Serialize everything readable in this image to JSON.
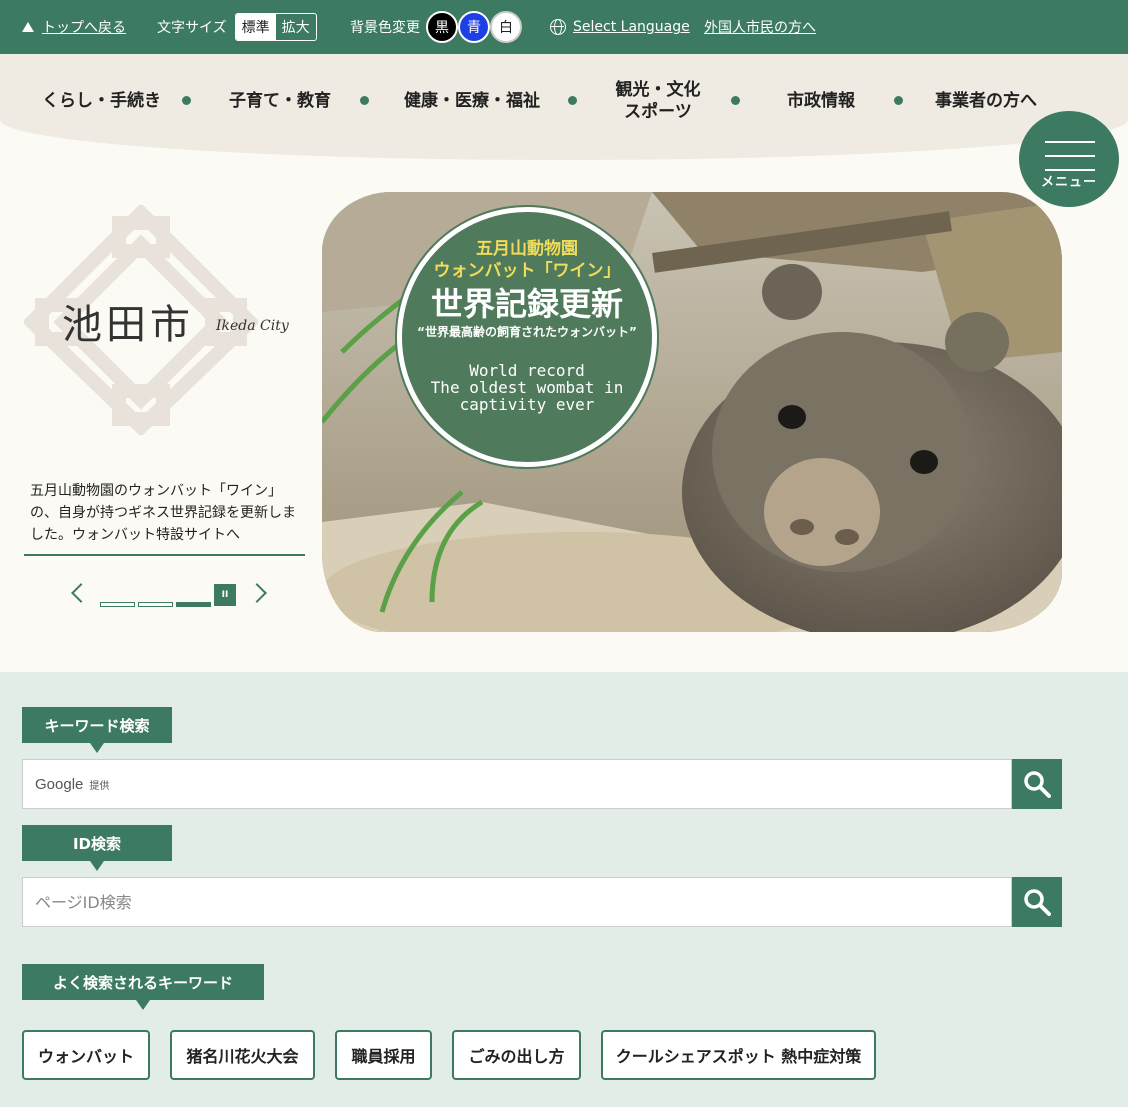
{
  "topbar": {
    "back_to_top": "トップへ戻る",
    "font_size_label": "文字サイズ",
    "font_size_options": [
      "標準",
      "拡大"
    ],
    "bg_color_label": "背景色変更",
    "bg_color_options": [
      "黒",
      "青",
      "白"
    ],
    "select_language": "Select Language",
    "foreign_residents": "外国人市民の方へ"
  },
  "nav": {
    "items": [
      "くらし・手続き",
      "子育て・教育",
      "健康・医療・福祉",
      "観光・文化",
      "スポーツ",
      "市政情報",
      "事業者の方へ"
    ]
  },
  "menu_button": {
    "label": "メニュー"
  },
  "logo": {
    "name": "池田市",
    "subtitle": "Ikeda City"
  },
  "slider": {
    "caption": "五月山動物園のウォンバット「ワイン」の、自身が持つギネス世界記録を更新しました。ウォンバット特設サイトへ",
    "current_slide": 3,
    "total_slides": 3,
    "pause_symbol": "II"
  },
  "hero_badge": {
    "line1": "五月山動物園",
    "line2": "ウォンバット「ワイン」",
    "line3": "世界記録更新",
    "line4": "“世界最高齢の飼育されたウォンバット”",
    "line5": "World record",
    "line6": "The oldest wombat in",
    "line7": "captivity ever"
  },
  "search": {
    "keyword_label": "キーワード検索",
    "google_text": "Google",
    "google_provided": "提供",
    "id_label": "ID検索",
    "id_placeholder": "ページID検索",
    "popular_label": "よく検索されるキーワード",
    "popular_keywords": [
      "ウォンバット",
      "猪名川花火大会",
      "職員採用",
      "ごみの出し方",
      "クールシェアスポット 熱中症対策"
    ]
  },
  "colors": {
    "accent": "#3c7a62",
    "search_bg": "#e3ede7",
    "nav_band": "#efebe2"
  }
}
